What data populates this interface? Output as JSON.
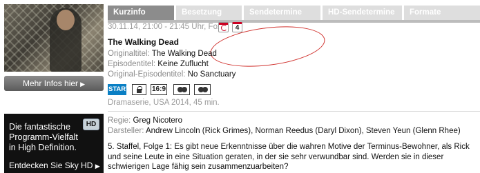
{
  "sidebar": {
    "more_button": "Mehr Infos hier",
    "more_arrow": "▶",
    "ad": {
      "text": "Die fantastische Programm-Vielfalt in High Definition.",
      "badge": "HD",
      "cta": "Entdecken Sie Sky HD",
      "cta_arrow": "▶"
    }
  },
  "tabs": [
    "Kurzinfo",
    "Besetzung",
    "Sendetermine",
    "HD-Sendetermine",
    "Formate"
  ],
  "active_tab": "Kurzinfo",
  "broadcast": {
    "airtime": "30.11.14, 21:00 - 21:45 Uhr, Fox",
    "calendar_day": "4",
    "icons": [
      "reminder-clock-icon",
      "calendar-icon"
    ]
  },
  "title": "The Walking Dead",
  "meta": [
    {
      "key": "Originaltitel:",
      "value": "The Walking Dead"
    },
    {
      "key": "Episodentitel:",
      "value": "Keine Zuflucht"
    },
    {
      "key": "Original-Episodentitel:",
      "value": "No Sanctuary"
    }
  ],
  "flags": {
    "start": "START",
    "aspect": "16:9"
  },
  "genre": "Dramaserie, USA 2014, 45 min.",
  "credits": {
    "regie_key": "Regie:",
    "regie_value": "Greg Nicotero",
    "darsteller_key": "Darsteller:",
    "darsteller_value": "Andrew Lincoln (Rick Grimes), Norman Reedus (Daryl Dixon), Steven Yeun (Glenn Rhee)"
  },
  "description": "5. Staffel, Folge 1: Es gibt neue Erkenntnisse über die wahren Motive der Terminus-Bewohner, als Rick und seine Leute in eine Situation geraten, in der sie sehr verwundbar sind. Werden sie in dieser schwierigen Lage fähig sein zusammenzuarbeiten?",
  "colors": {
    "active_tab": "#8c8c8c",
    "inactive_tab": "#dedede",
    "start_badge": "#0a7fc4",
    "annotation_circle": "#d0302c"
  }
}
